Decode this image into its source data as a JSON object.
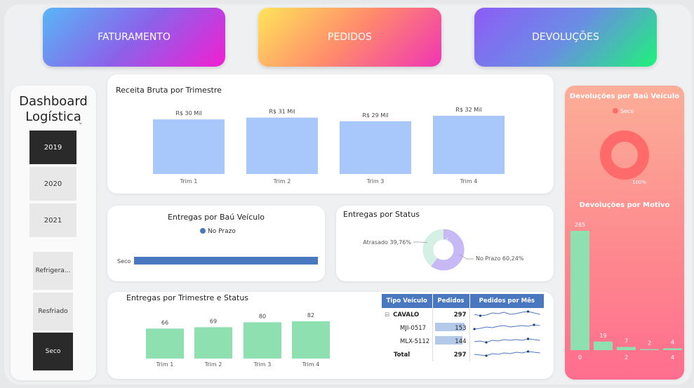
{
  "nav": {
    "faturamento": "FATURAMENTO",
    "pedidos": "PEDIDOS",
    "devolucoes": "DEVOLUÇÕES"
  },
  "sidebar": {
    "title_line1": "Dashboard",
    "title_line2": "Logística",
    "years": [
      {
        "label": "2019",
        "selected": true
      },
      {
        "label": "2020",
        "selected": false
      },
      {
        "label": "2021",
        "selected": false
      }
    ],
    "vehicle_types": [
      {
        "label": "Refrigera...",
        "selected": false
      },
      {
        "label": "Resfriado",
        "selected": false
      },
      {
        "label": "Seco",
        "selected": true
      }
    ]
  },
  "receita": {
    "title": "Receita Bruta por Trimestre"
  },
  "entregas_bau": {
    "title": "Entregas por Baú Veículo",
    "legend": "No Prazo"
  },
  "entregas_status": {
    "title": "Entregas por Status"
  },
  "entregas_trim": {
    "title": "Entregas por Trimestre e Status"
  },
  "table": {
    "headers": [
      "Tipo Veículo",
      "Pedidos",
      "Pedidos por Mês"
    ],
    "rows": [
      {
        "label": "CAVALO",
        "value": "297",
        "group": true
      },
      {
        "label": "MJI-0517",
        "value": "153",
        "group": false,
        "bar": 0.96
      },
      {
        "label": "MLX-5112",
        "value": "144",
        "group": false,
        "bar": 0.9
      }
    ],
    "total_label": "Total",
    "total_value": "297",
    "expand_symbol": "⊟"
  },
  "devolucoes": {
    "bau_title": "Devoluções por Baú Veículo",
    "bau_legend": "Seco",
    "motivo_title": "Devoluções por Motivo"
  },
  "colors": {
    "revenue_bar": "#a8c8fb",
    "delivery_bar": "#8ee0b1",
    "status_bar": "#4a78c0",
    "donut_late": "#d4f0e4",
    "donut_ontime": "#c7b8f6",
    "return_donut": "#ff6b6b"
  },
  "chart_data": [
    {
      "type": "bar",
      "title": "Receita Bruta por Trimestre",
      "categories": [
        "Trim 1",
        "Trim 2",
        "Trim 3",
        "Trim 4"
      ],
      "values": [
        30,
        31,
        29,
        32
      ],
      "labels": [
        "R$ 30 Mil",
        "R$ 31 Mil",
        "R$ 29 Mil",
        "R$ 32 Mil"
      ],
      "ylim": [
        0,
        32
      ]
    },
    {
      "type": "bar",
      "title": "Entregas por Baú Veículo",
      "orientation": "horizontal",
      "categories": [
        "Seco"
      ],
      "series": [
        {
          "name": "No Prazo",
          "values": [
            1
          ]
        }
      ]
    },
    {
      "type": "pie",
      "title": "Entregas por Status",
      "donut": true,
      "categories": [
        "No Prazo",
        "Atrasado"
      ],
      "values": [
        60.24,
        39.76
      ],
      "labels": [
        "No Prazo 60,24%",
        "Atrasado 39,76%"
      ]
    },
    {
      "type": "bar",
      "title": "Entregas por Trimestre e Status",
      "categories": [
        "Trim 1",
        "Trim 2",
        "Trim 3",
        "Trim 4"
      ],
      "values": [
        66,
        69,
        80,
        82
      ],
      "ylim": [
        0,
        82
      ]
    },
    {
      "type": "pie",
      "title": "Devoluções por Baú Veículo",
      "donut": true,
      "categories": [
        "Seco"
      ],
      "values": [
        100
      ],
      "labels": [
        "100%"
      ]
    },
    {
      "type": "bar",
      "title": "Devoluções por Motivo",
      "categories": [
        "0",
        "1",
        "2",
        "3",
        "4"
      ],
      "tick_labels": [
        "0",
        "",
        "2",
        "",
        "4"
      ],
      "values": [
        265,
        19,
        7,
        2,
        4
      ],
      "ylim": [
        0,
        265
      ]
    }
  ]
}
